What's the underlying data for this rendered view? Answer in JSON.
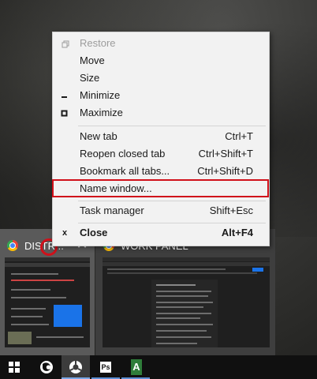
{
  "context_menu": {
    "items": [
      {
        "label": "Restore",
        "shortcut": "",
        "icon": "restore-icon",
        "disabled": true
      },
      {
        "label": "Move",
        "shortcut": ""
      },
      {
        "label": "Size",
        "shortcut": ""
      },
      {
        "label": "Minimize",
        "shortcut": "",
        "icon": "minimize-icon"
      },
      {
        "label": "Maximize",
        "shortcut": "",
        "icon": "maximize-icon"
      },
      {
        "label": "New tab",
        "shortcut": "Ctrl+T"
      },
      {
        "label": "Reopen closed tab",
        "shortcut": "Ctrl+Shift+T"
      },
      {
        "label": "Bookmark all tabs...",
        "shortcut": "Ctrl+Shift+D"
      },
      {
        "label": "Name window...",
        "shortcut": "",
        "highlighted": true
      },
      {
        "label": "Task manager",
        "shortcut": "Shift+Esc"
      },
      {
        "label": "Close",
        "shortcut": "Alt+F4",
        "icon": "close-x-icon",
        "bold": true
      }
    ],
    "close_glyph": "x",
    "highlight_color": "#d0101a"
  },
  "previews": [
    {
      "title": "DISTR...",
      "icon": "chrome-icon",
      "close_glyph": "✕",
      "active": true
    },
    {
      "title": "WORK PANEL",
      "icon": "chrome-icon",
      "active": false
    }
  ],
  "taskbar": {
    "items": [
      {
        "name": "windows-start",
        "icon": "windows-logo-icon"
      },
      {
        "name": "firefox",
        "icon": "firefox-icon"
      },
      {
        "name": "chrome",
        "icon": "chrome-icon",
        "active": true
      },
      {
        "name": "photoshop",
        "icon": "photoshop-icon",
        "label": "Ps"
      },
      {
        "name": "app-a",
        "icon": "a-app-icon",
        "label": "A"
      }
    ]
  }
}
